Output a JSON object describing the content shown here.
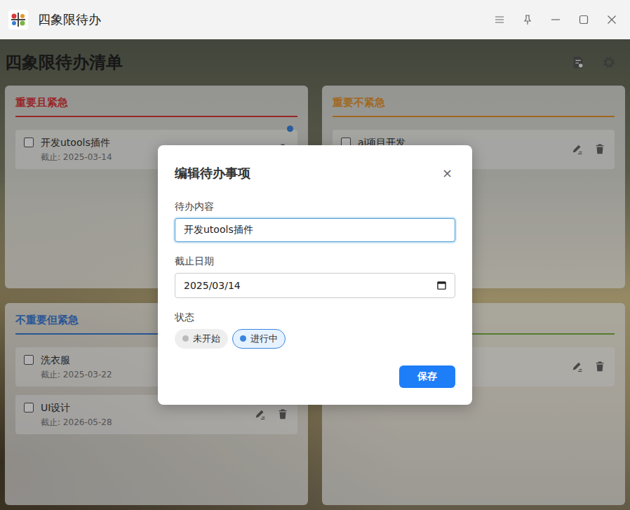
{
  "window": {
    "title": "四象限待办"
  },
  "page": {
    "title": "四象限待办清单"
  },
  "quadrants": [
    {
      "title": "重要且紧急",
      "color": "#d9383a",
      "items": [
        {
          "text": "开发utools插件",
          "due": "截止: 2025-03-14",
          "checked": false,
          "in_progress": true
        }
      ]
    },
    {
      "title": "重要不紧急",
      "color": "#e6962e",
      "items": [
        {
          "text": "ai项目开发",
          "due": "",
          "checked": false,
          "in_progress": false
        }
      ]
    },
    {
      "title": "不重要但紧急",
      "color": "#3a7bd5",
      "items": [
        {
          "text": "洗衣服",
          "due": "截止: 2025-03-22",
          "checked": false,
          "in_progress": false
        },
        {
          "text": "UI设计",
          "due": "截止: 2026-05-28",
          "checked": false,
          "in_progress": false
        }
      ]
    },
    {
      "title": "",
      "color": "#7cb342",
      "items": [
        {
          "text": "",
          "due": "",
          "checked": false,
          "in_progress": false
        }
      ]
    }
  ],
  "dialog": {
    "title": "编辑待办事项",
    "close": "×",
    "fields": [
      {
        "label": "待办内容",
        "value": "开发utools插件",
        "kind": "text",
        "focused": true
      },
      {
        "label": "截止日期",
        "value": "2025/03/14",
        "kind": "date",
        "focused": false
      }
    ],
    "status": {
      "label": "状态",
      "options": [
        {
          "label": "未开始",
          "selected": false
        },
        {
          "label": "进行中",
          "selected": true
        }
      ]
    },
    "save": "保存"
  }
}
